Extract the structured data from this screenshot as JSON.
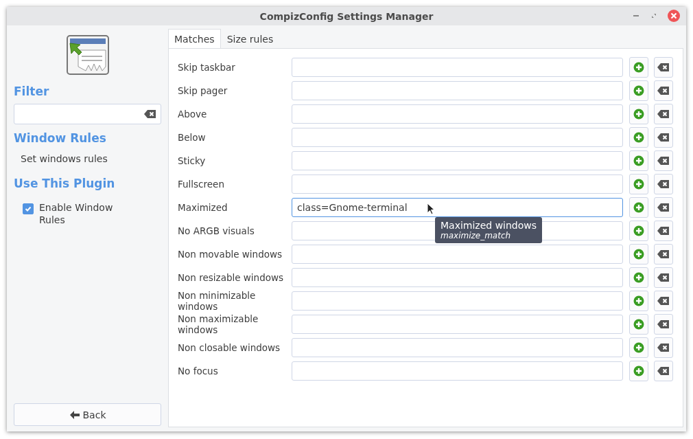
{
  "window": {
    "title": "CompizConfig Settings Manager"
  },
  "sidebar": {
    "filter": {
      "heading": "Filter"
    },
    "section": {
      "heading": "Window Rules",
      "description": "Set windows rules"
    },
    "plugin": {
      "heading": "Use This Plugin",
      "checkbox": {
        "label": "Enable Window Rules",
        "checked": true
      }
    },
    "back_button": "Back"
  },
  "tabs": [
    {
      "label": "Matches",
      "selected": true
    },
    {
      "label": "Size rules",
      "selected": false
    }
  ],
  "rows": [
    {
      "label": "Skip taskbar",
      "focused": false
    },
    {
      "label": "Skip pager",
      "focused": false
    },
    {
      "label": "Above",
      "focused": false
    },
    {
      "label": "Below",
      "focused": false
    },
    {
      "label": "Sticky",
      "focused": false
    },
    {
      "label": "Fullscreen",
      "focused": false
    },
    {
      "label": "Maximized",
      "value": "class=Gnome-terminal",
      "focused": true,
      "tooltip": {
        "title": "Maximized windows",
        "option": "maximize_match"
      }
    },
    {
      "label": "No ARGB visuals",
      "focused": false
    },
    {
      "label": "Non movable windows",
      "focused": false
    },
    {
      "label": "Non resizable windows",
      "focused": false
    },
    {
      "label": "Non minimizable windows",
      "focused": false
    },
    {
      "label": "Non maximizable windows",
      "focused": false
    },
    {
      "label": "Non closable windows",
      "focused": false
    },
    {
      "label": "No focus",
      "focused": false
    }
  ]
}
